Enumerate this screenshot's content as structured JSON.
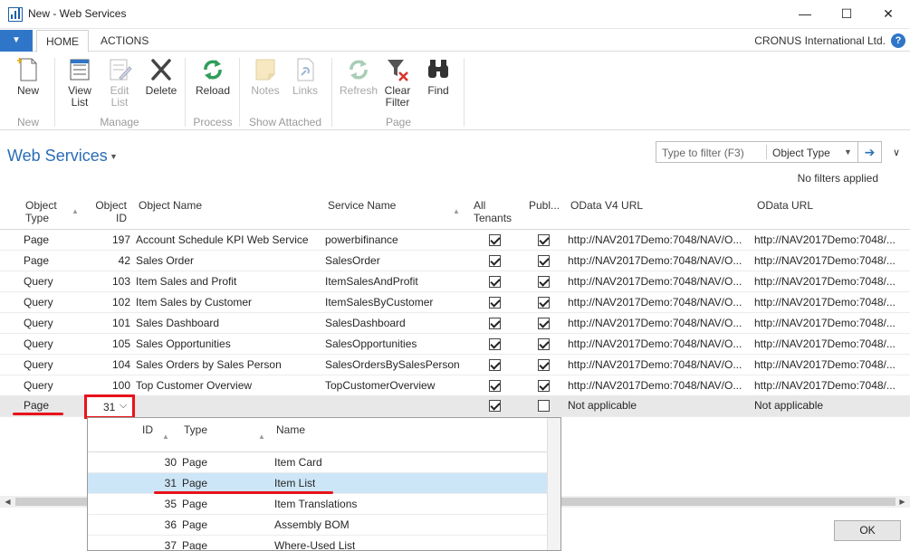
{
  "window": {
    "title": "New - Web Services",
    "minimize": "—",
    "maximize": "☐",
    "close": "✕"
  },
  "tabs": {
    "file_glyph": "▼",
    "items": [
      {
        "label": "HOME",
        "active": true
      },
      {
        "label": "ACTIONS",
        "active": false
      }
    ],
    "company": "CRONUS International Ltd.",
    "help_glyph": "?"
  },
  "ribbon": {
    "buttons": [
      {
        "label": "New",
        "icon": "new-document-icon",
        "enabled": true
      },
      {
        "label": "View\nList",
        "icon": "view-list-icon",
        "enabled": true
      },
      {
        "label": "Edit\nList",
        "icon": "edit-list-icon",
        "enabled": false
      },
      {
        "label": "Delete",
        "icon": "delete-icon",
        "enabled": true
      },
      {
        "label": "Reload",
        "icon": "reload-icon",
        "enabled": true
      },
      {
        "label": "Notes",
        "icon": "notes-icon",
        "enabled": false
      },
      {
        "label": "Links",
        "icon": "links-icon",
        "enabled": false
      },
      {
        "label": "Refresh",
        "icon": "refresh-icon",
        "enabled": false
      },
      {
        "label": "Clear\nFilter",
        "icon": "clear-filter-icon",
        "enabled": true
      },
      {
        "label": "Find",
        "icon": "find-icon",
        "enabled": true
      }
    ],
    "groups": [
      "New",
      "Manage",
      "Process",
      "Show Attached",
      "Page"
    ]
  },
  "page": {
    "title": "Web Services",
    "title_caret": "▼",
    "filter_placeholder": "Type to filter (F3)",
    "filter_field": "Object Type",
    "filter_caret": "▼",
    "filter_go": "➔",
    "collapse_glyph": "∨",
    "no_filters": "No filters applied"
  },
  "grid": {
    "columns": {
      "object_type": "Object\nType",
      "object_id": "Object\nID",
      "object_name": "Object Name",
      "service_name": "Service Name",
      "all_tenants": "All\nTenants",
      "published": "Publ...",
      "odata_v4_url": "OData V4 URL",
      "odata_url": "OData URL"
    },
    "sort_glyph": "▲",
    "rows": [
      {
        "type": "Page",
        "id": "197",
        "name": "Account Schedule KPI Web Service",
        "service": "powerbifinance",
        "all_tenants": true,
        "published": true,
        "odata_v4": "http://NAV2017Demo:7048/NAV/O...",
        "odata": "http://NAV2017Demo:7048/..."
      },
      {
        "type": "Page",
        "id": "42",
        "name": "Sales Order",
        "service": "SalesOrder",
        "all_tenants": true,
        "published": true,
        "odata_v4": "http://NAV2017Demo:7048/NAV/O...",
        "odata": "http://NAV2017Demo:7048/..."
      },
      {
        "type": "Query",
        "id": "103",
        "name": "Item Sales and Profit",
        "service": "ItemSalesAndProfit",
        "all_tenants": true,
        "published": true,
        "odata_v4": "http://NAV2017Demo:7048/NAV/O...",
        "odata": "http://NAV2017Demo:7048/..."
      },
      {
        "type": "Query",
        "id": "102",
        "name": "Item Sales by Customer",
        "service": "ItemSalesByCustomer",
        "all_tenants": true,
        "published": true,
        "odata_v4": "http://NAV2017Demo:7048/NAV/O...",
        "odata": "http://NAV2017Demo:7048/..."
      },
      {
        "type": "Query",
        "id": "101",
        "name": "Sales Dashboard",
        "service": "SalesDashboard",
        "all_tenants": true,
        "published": true,
        "odata_v4": "http://NAV2017Demo:7048/NAV/O...",
        "odata": "http://NAV2017Demo:7048/..."
      },
      {
        "type": "Query",
        "id": "105",
        "name": "Sales Opportunities",
        "service": "SalesOpportunities",
        "all_tenants": true,
        "published": true,
        "odata_v4": "http://NAV2017Demo:7048/NAV/O...",
        "odata": "http://NAV2017Demo:7048/..."
      },
      {
        "type": "Query",
        "id": "104",
        "name": "Sales Orders by Sales Person",
        "service": "SalesOrdersBySalesPerson",
        "all_tenants": true,
        "published": true,
        "odata_v4": "http://NAV2017Demo:7048/NAV/O...",
        "odata": "http://NAV2017Demo:7048/..."
      },
      {
        "type": "Query",
        "id": "100",
        "name": "Top Customer Overview",
        "service": "TopCustomerOverview",
        "all_tenants": true,
        "published": true,
        "odata_v4": "http://NAV2017Demo:7048/NAV/O...",
        "odata": "http://NAV2017Demo:7048/..."
      }
    ],
    "new_row": {
      "type": "Page",
      "id": "31",
      "id_caret": "⌵",
      "all_tenants": true,
      "published": false,
      "odata_v4": "Not applicable",
      "odata": "Not applicable"
    }
  },
  "lookup": {
    "columns": {
      "id": "ID",
      "type": "Type",
      "name": "Name"
    },
    "sort_glyph": "▲",
    "rows": [
      {
        "id": "30",
        "type": "Page",
        "name": "Item Card",
        "selected": false
      },
      {
        "id": "31",
        "type": "Page",
        "name": "Item List",
        "selected": true
      },
      {
        "id": "35",
        "type": "Page",
        "name": "Item Translations",
        "selected": false
      },
      {
        "id": "36",
        "type": "Page",
        "name": "Assembly BOM",
        "selected": false
      },
      {
        "id": "37",
        "type": "Page",
        "name": "Where-Used List",
        "selected": false
      }
    ]
  },
  "scrollbar": {
    "left_arrow": "◀",
    "right_arrow": "▶"
  },
  "footer": {
    "ok_label": "OK"
  },
  "colors": {
    "accent": "#2a6db5",
    "highlight": "#e8121b",
    "selection": "#cde6f7"
  }
}
